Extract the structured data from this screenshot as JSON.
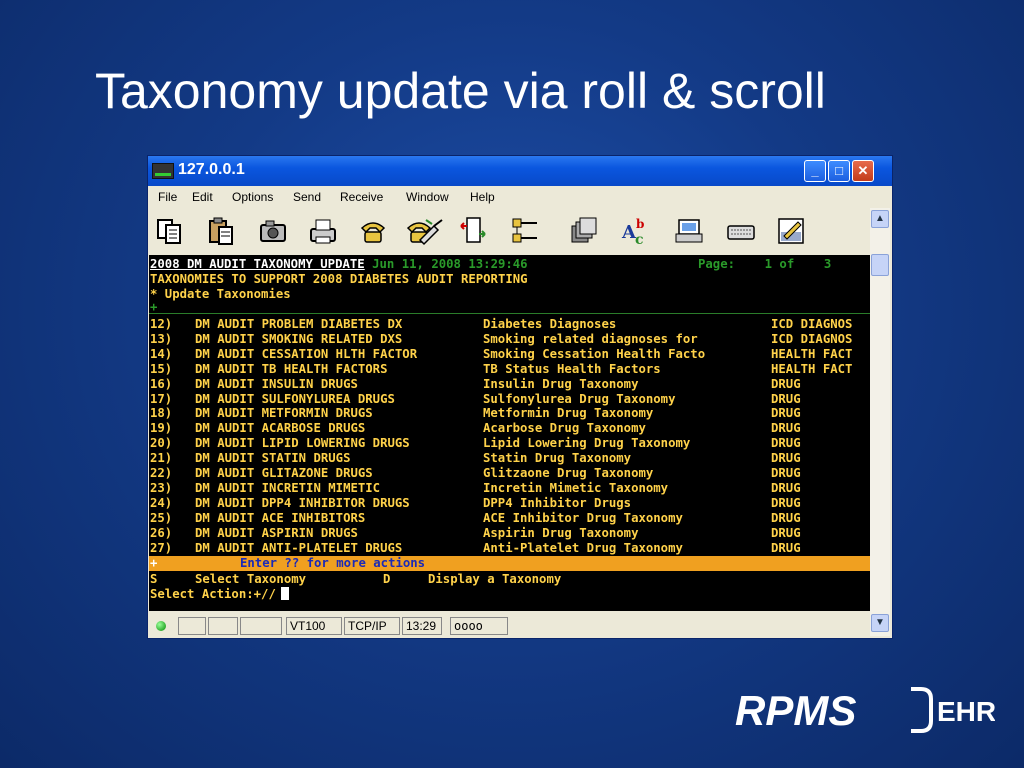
{
  "slide": {
    "title": "Taxonomy update via roll & scroll"
  },
  "window": {
    "title": "127.0.0.1"
  },
  "menu": [
    "File",
    "Edit",
    "Options",
    "Send",
    "Receive",
    "Window",
    "Help"
  ],
  "toolbar_icons": [
    "copy-icon",
    "paste-icon",
    "camera-icon",
    "print-icon",
    "phone-icon",
    "connect-icon",
    "disconnect-icon",
    "transfer-icon",
    "tree-icon",
    "files-icon",
    "spellcheck-icon",
    "printer-icon",
    "keyboard-icon",
    "edit-icon"
  ],
  "terminal": {
    "header_left": "2008 DM AUDIT TAXONOMY UPDATE",
    "header_date": "Jun 11, 2008 13:29:46",
    "header_page": "Page:    1 of    3",
    "subtitle": "TAXONOMIES TO SUPPORT 2008 DIABETES AUDIT REPORTING",
    "section": "* Update Taxonomies",
    "plus": "+",
    "rows": [
      {
        "num": "12)",
        "name": "DM AUDIT PROBLEM DIABETES DX",
        "desc": "Diabetes Diagnoses",
        "type": "ICD DIAGNOS"
      },
      {
        "num": "13)",
        "name": "DM AUDIT SMOKING RELATED DXS",
        "desc": "Smoking related diagnoses for",
        "type": "ICD DIAGNOS"
      },
      {
        "num": "14)",
        "name": "DM AUDIT CESSATION HLTH FACTOR",
        "desc": "Smoking Cessation Health Facto",
        "type": "HEALTH FACT"
      },
      {
        "num": "15)",
        "name": "DM AUDIT TB HEALTH FACTORS",
        "desc": "TB Status Health Factors",
        "type": "HEALTH FACT"
      },
      {
        "num": "16)",
        "name": "DM AUDIT INSULIN DRUGS",
        "desc": "Insulin Drug Taxonomy",
        "type": "DRUG"
      },
      {
        "num": "17)",
        "name": "DM AUDIT SULFONYLUREA DRUGS",
        "desc": "Sulfonylurea Drug Taxonomy",
        "type": "DRUG"
      },
      {
        "num": "18)",
        "name": "DM AUDIT METFORMIN DRUGS",
        "desc": "Metformin Drug Taxonomy",
        "type": "DRUG"
      },
      {
        "num": "19)",
        "name": "DM AUDIT ACARBOSE DRUGS",
        "desc": "Acarbose Drug Taxonomy",
        "type": "DRUG"
      },
      {
        "num": "20)",
        "name": "DM AUDIT LIPID LOWERING DRUGS",
        "desc": "Lipid Lowering Drug Taxonomy",
        "type": "DRUG"
      },
      {
        "num": "21)",
        "name": "DM AUDIT STATIN DRUGS",
        "desc": "Statin Drug Taxonomy",
        "type": "DRUG"
      },
      {
        "num": "22)",
        "name": "DM AUDIT GLITAZONE DRUGS",
        "desc": "Glitzaone Drug Taxonomy",
        "type": "DRUG"
      },
      {
        "num": "23)",
        "name": "DM AUDIT INCRETIN MIMETIC",
        "desc": "Incretin Mimetic Taxonomy",
        "type": "DRUG"
      },
      {
        "num": "24)",
        "name": "DM AUDIT DPP4 INHIBITOR DRUGS",
        "desc": "DPP4 Inhibitor Drugs",
        "type": "DRUG"
      },
      {
        "num": "25)",
        "name": "DM AUDIT ACE INHIBITORS",
        "desc": "ACE Inhibitor Drug Taxonomy",
        "type": "DRUG"
      },
      {
        "num": "26)",
        "name": "DM AUDIT ASPIRIN DRUGS",
        "desc": "Aspirin Drug Taxonomy",
        "type": "DRUG"
      },
      {
        "num": "27)",
        "name": "DM AUDIT ANTI-PLATELET DRUGS",
        "desc": "Anti-Platelet Drug Taxonomy",
        "type": "DRUG"
      }
    ],
    "more_plus": "+",
    "more": "Enter ?? for more actions",
    "action_s_key": "S",
    "action_s": "Select Taxonomy",
    "action_d_key": "D",
    "action_d": "Display a Taxonomy",
    "prompt": "Select Action:+//"
  },
  "status": {
    "emulation": "VT100",
    "protocol": "TCP/IP",
    "time": "13:29",
    "lights": "oooo"
  },
  "logo": {
    "text": "RPMS",
    "suffix": "EHR"
  },
  "colors": {
    "slide_bg": "#133a86",
    "terminal_bg": "#000000",
    "highlight": "#ffd24a",
    "action_bar": "#f0a020",
    "titlebar": "#0a56df"
  }
}
